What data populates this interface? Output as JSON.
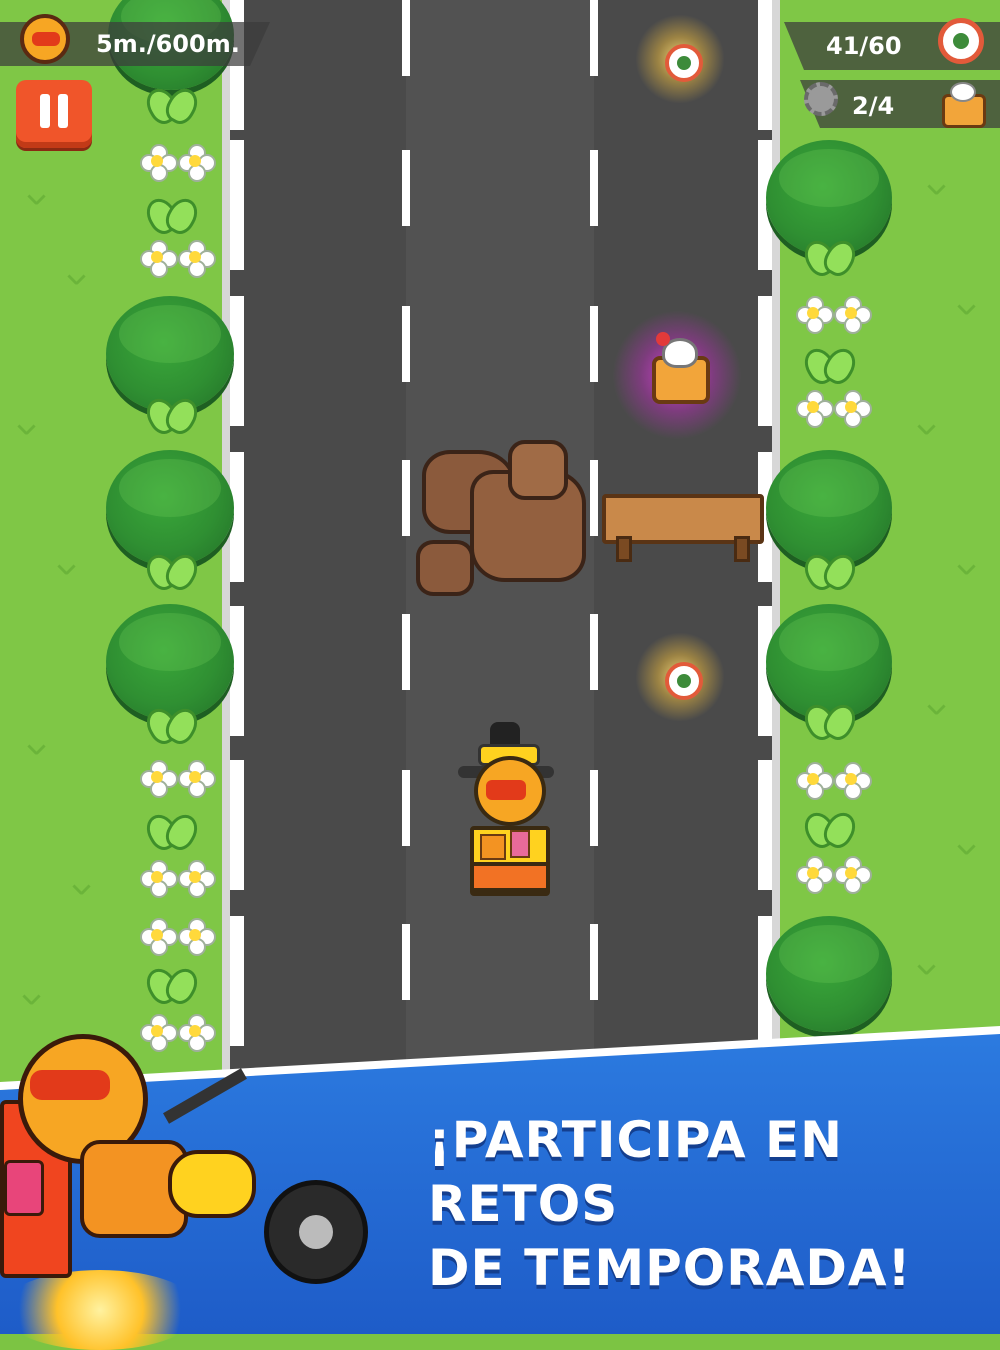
{
  "hud": {
    "distance_text": "5m./600m.",
    "coin_count": "41/60",
    "dessert_count": "2/4",
    "pause_icon": "pause-icon"
  },
  "banner": {
    "line1": "¡PARTICIPA EN RETOS",
    "line2": "DE TEMPORADA!"
  },
  "colors": {
    "grass": "#7fc746",
    "road": "#4a4a4a",
    "banner": "#2c7be0",
    "pause": "#f0552a"
  }
}
